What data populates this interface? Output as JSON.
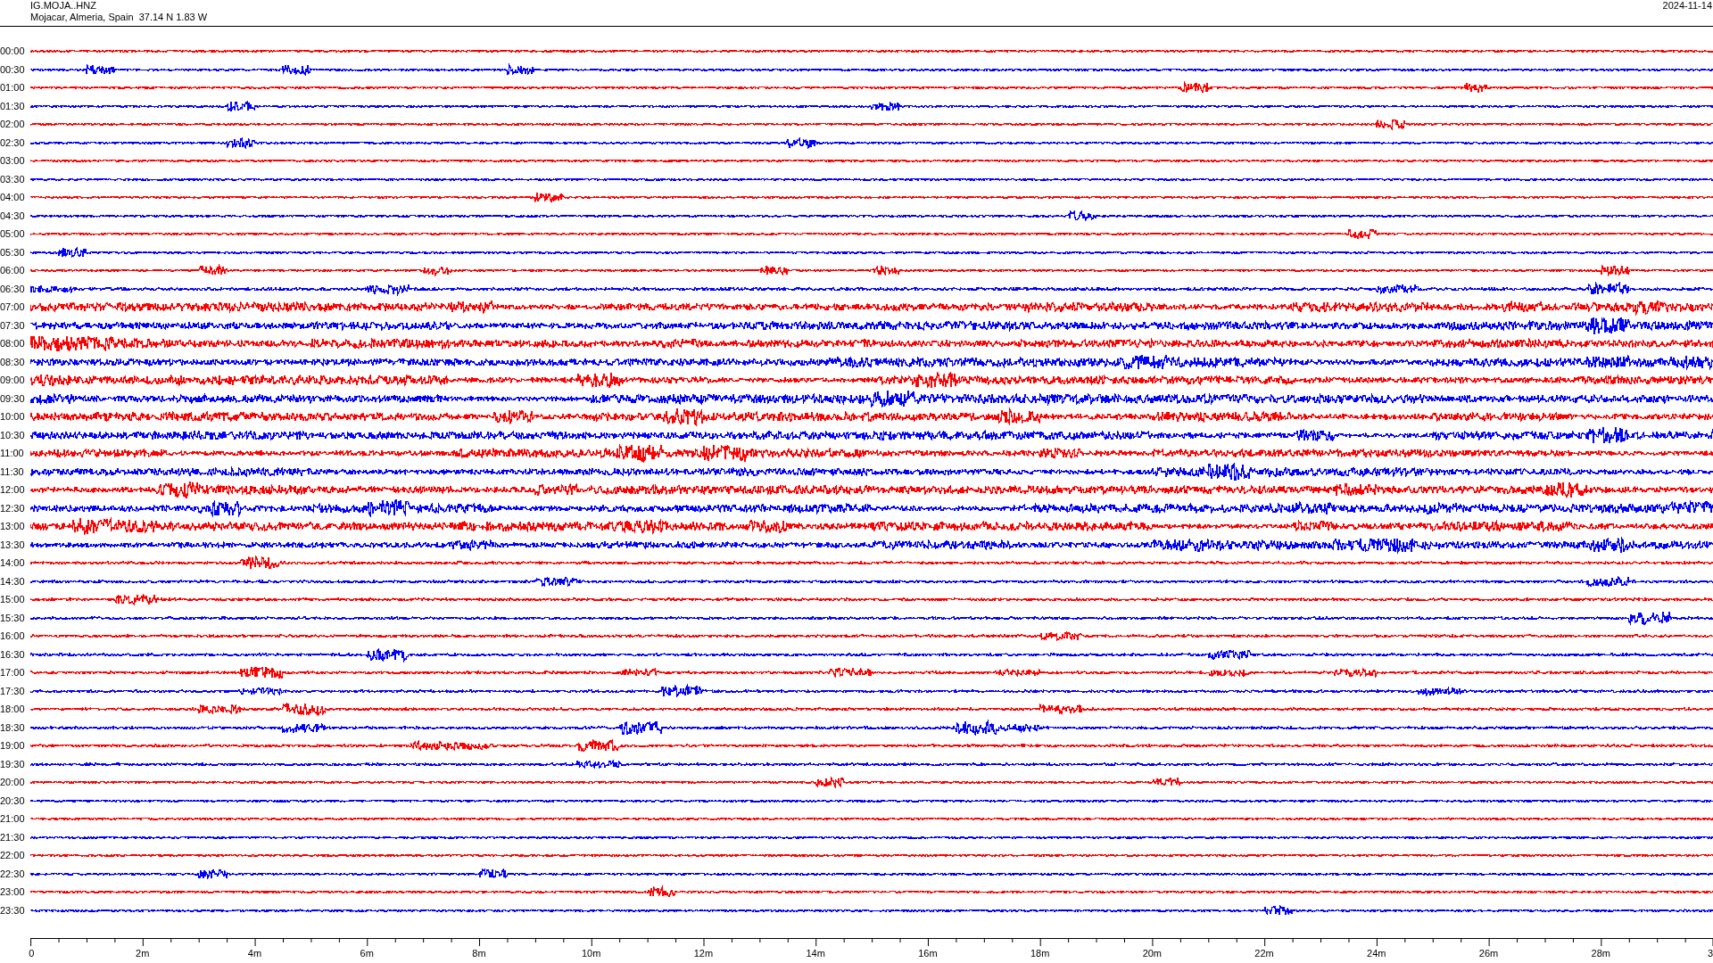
{
  "header": {
    "station": "IG.MOJA..HNZ",
    "location": "Mojacar, Almeria, Spain  37.14 N 1.83 W",
    "date": "2024-11-14"
  },
  "traces": [
    {
      "label": "00:00",
      "color": "#ff0000"
    },
    {
      "label": "00:30",
      "color": "#0000ff"
    },
    {
      "label": "01:00",
      "color": "#ff0000"
    },
    {
      "label": "01:30",
      "color": "#0000ff"
    },
    {
      "label": "02:00",
      "color": "#ff0000"
    },
    {
      "label": "02:30",
      "color": "#0000ff"
    },
    {
      "label": "03:00",
      "color": "#ff0000"
    },
    {
      "label": "03:30",
      "color": "#0000ff"
    },
    {
      "label": "04:00",
      "color": "#ff0000"
    },
    {
      "label": "04:30",
      "color": "#0000ff"
    },
    {
      "label": "05:00",
      "color": "#ff0000"
    },
    {
      "label": "05:30",
      "color": "#0000ff"
    },
    {
      "label": "06:00",
      "color": "#ff0000"
    },
    {
      "label": "06:30",
      "color": "#0000ff"
    },
    {
      "label": "07:00",
      "color": "#ff0000"
    },
    {
      "label": "07:30",
      "color": "#0000ff"
    },
    {
      "label": "08:00",
      "color": "#ff0000"
    },
    {
      "label": "08:30",
      "color": "#0000ff"
    },
    {
      "label": "09:00",
      "color": "#ff0000"
    },
    {
      "label": "09:30",
      "color": "#0000ff"
    },
    {
      "label": "10:00",
      "color": "#ff0000"
    },
    {
      "label": "10:30",
      "color": "#0000ff"
    },
    {
      "label": "11:00",
      "color": "#ff0000"
    },
    {
      "label": "11:30",
      "color": "#0000ff"
    },
    {
      "label": "12:00",
      "color": "#ff0000"
    },
    {
      "label": "12:30",
      "color": "#0000ff"
    },
    {
      "label": "13:00",
      "color": "#ff0000"
    },
    {
      "label": "13:30",
      "color": "#0000ff"
    },
    {
      "label": "14:00",
      "color": "#ff0000"
    },
    {
      "label": "14:30",
      "color": "#0000ff"
    },
    {
      "label": "15:00",
      "color": "#ff0000"
    },
    {
      "label": "15:30",
      "color": "#0000ff"
    },
    {
      "label": "16:00",
      "color": "#ff0000"
    },
    {
      "label": "16:30",
      "color": "#0000ff"
    },
    {
      "label": "17:00",
      "color": "#ff0000"
    },
    {
      "label": "17:30",
      "color": "#0000ff"
    },
    {
      "label": "18:00",
      "color": "#ff0000"
    },
    {
      "label": "18:30",
      "color": "#0000ff"
    },
    {
      "label": "19:00",
      "color": "#ff0000"
    },
    {
      "label": "19:30",
      "color": "#0000ff"
    },
    {
      "label": "20:00",
      "color": "#ff0000"
    },
    {
      "label": "20:30",
      "color": "#0000ff"
    },
    {
      "label": "21:00",
      "color": "#ff0000"
    },
    {
      "label": "21:30",
      "color": "#0000ff"
    },
    {
      "label": "22:00",
      "color": "#ff0000"
    },
    {
      "label": "22:30",
      "color": "#0000ff"
    },
    {
      "label": "23:00",
      "color": "#ff0000"
    },
    {
      "label": "23:30",
      "color": "#0000ff"
    }
  ],
  "x_axis": {
    "labels": [
      "0",
      "2m",
      "4m",
      "6m",
      "8m",
      "10m",
      "12m",
      "14m",
      "16m",
      "18m",
      "20m",
      "22m",
      "24m",
      "26m",
      "28m",
      "3"
    ]
  }
}
